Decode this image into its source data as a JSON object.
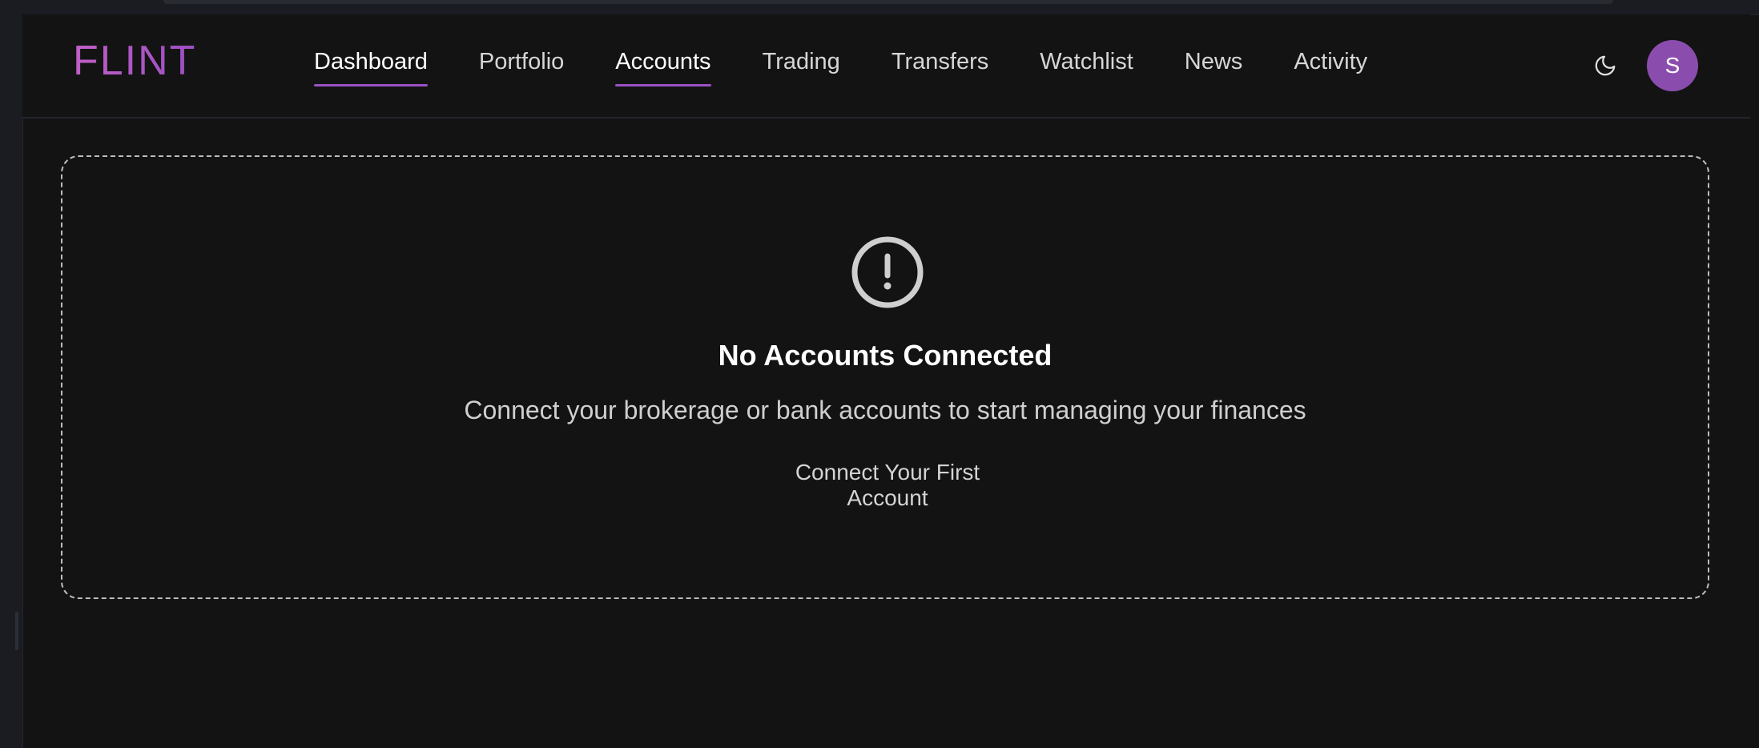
{
  "app": {
    "logo_text": "FLINT"
  },
  "nav": {
    "items": [
      {
        "label": "Dashboard",
        "active": true
      },
      {
        "label": "Portfolio",
        "active": false
      },
      {
        "label": "Accounts",
        "active": true
      },
      {
        "label": "Trading",
        "active": false
      },
      {
        "label": "Transfers",
        "active": false
      },
      {
        "label": "Watchlist",
        "active": false
      },
      {
        "label": "News",
        "active": false
      },
      {
        "label": "Activity",
        "active": false
      }
    ]
  },
  "header": {
    "theme_toggle_icon": "moon-icon",
    "avatar_initial": "S"
  },
  "empty_state": {
    "icon": "alert-circle-icon",
    "title": "No Accounts Connected",
    "description": "Connect your brokerage or bank accounts to start managing your finances",
    "cta_label": "Connect Your First Account"
  },
  "colors": {
    "background": "#131313",
    "accent": "#9b52c4",
    "avatar": "#8a4dad",
    "logo_gradient_start": "#c05fc6",
    "logo_gradient_end": "#9b4fc2"
  }
}
